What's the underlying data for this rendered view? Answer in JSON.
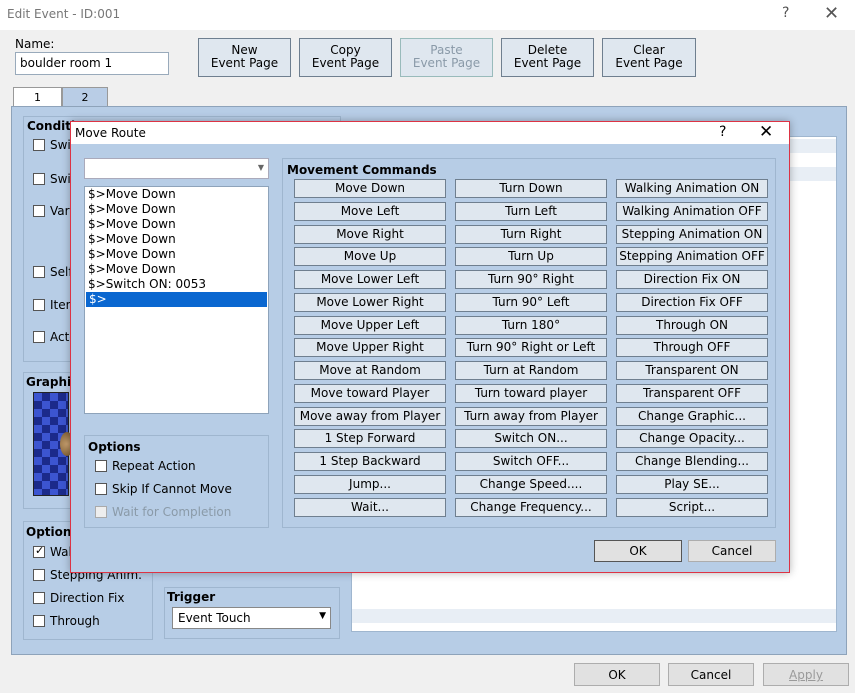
{
  "window": {
    "title": "Edit Event - ID:001",
    "help": "?",
    "close": "✕"
  },
  "event": {
    "name_label": "Name:",
    "name_value": "boulder room 1",
    "toolbar": [
      {
        "id": "new",
        "line1": "New",
        "line2": "Event Page",
        "enabled": true
      },
      {
        "id": "copy",
        "line1": "Copy",
        "line2": "Event Page",
        "enabled": true
      },
      {
        "id": "paste",
        "line1": "Paste",
        "line2": "Event Page",
        "enabled": false
      },
      {
        "id": "delete",
        "line1": "Delete",
        "line2": "Event Page",
        "enabled": true
      },
      {
        "id": "clear",
        "line1": "Clear",
        "line2": "Event Page",
        "enabled": true
      }
    ],
    "tabs": [
      "1",
      "2"
    ]
  },
  "page": {
    "conditions_title": "Conditi",
    "conditions": [
      "Swi",
      "Swi",
      "Vari",
      "Self",
      "Iten",
      "Acto"
    ],
    "graphic_title": "Graphi",
    "options_title": "Options",
    "options": [
      {
        "label": "Wal",
        "checked": true
      },
      {
        "label": "Stepping Anim.",
        "checked": false
      },
      {
        "label": "Direction Fix",
        "checked": false
      },
      {
        "label": "Through",
        "checked": false
      }
    ],
    "trigger_title": "Trigger",
    "trigger_value": "Event Touch"
  },
  "footer": {
    "ok": "OK",
    "cancel": "Cancel",
    "apply": "Apply"
  },
  "move_route": {
    "title": "Move Route",
    "help": "?",
    "close": "✕",
    "target": "",
    "route": [
      "$>Move Down",
      "$>Move Down",
      "$>Move Down",
      "$>Move Down",
      "$>Move Down",
      "$>Move Down",
      "$>Switch ON: 0053",
      "$>"
    ],
    "selected_index": 7,
    "options_title": "Options",
    "options": [
      {
        "label": "Repeat Action",
        "checked": false,
        "enabled": true
      },
      {
        "label": "Skip If Cannot Move",
        "checked": false,
        "enabled": true
      },
      {
        "label": "Wait for Completion",
        "checked": false,
        "enabled": false
      }
    ],
    "commands_title": "Movement Commands",
    "commands": [
      [
        "Move Down",
        "Move Left",
        "Move Right",
        "Move Up",
        "Move Lower Left",
        "Move Lower Right",
        "Move Upper Left",
        "Move Upper Right",
        "Move at Random",
        "Move toward Player",
        "Move away from Player",
        "1 Step Forward",
        "1 Step Backward",
        "Jump...",
        "Wait..."
      ],
      [
        "Turn Down",
        "Turn Left",
        "Turn Right",
        "Turn Up",
        "Turn 90° Right",
        "Turn 90° Left",
        "Turn 180°",
        "Turn 90° Right or Left",
        "Turn at Random",
        "Turn toward player",
        "Turn away from Player",
        "Switch ON...",
        "Switch OFF...",
        "Change Speed....",
        "Change Frequency..."
      ],
      [
        "Walking Animation ON",
        "Walking Animation OFF",
        "Stepping Animation ON",
        "Stepping Animation OFF",
        "Direction Fix ON",
        "Direction Fix OFF",
        "Through ON",
        "Through OFF",
        "Transparent ON",
        "Transparent OFF",
        "Change Graphic...",
        "Change Opacity...",
        "Change Blending...",
        "Play SE...",
        "Script..."
      ]
    ],
    "ok": "OK",
    "cancel": "Cancel"
  }
}
